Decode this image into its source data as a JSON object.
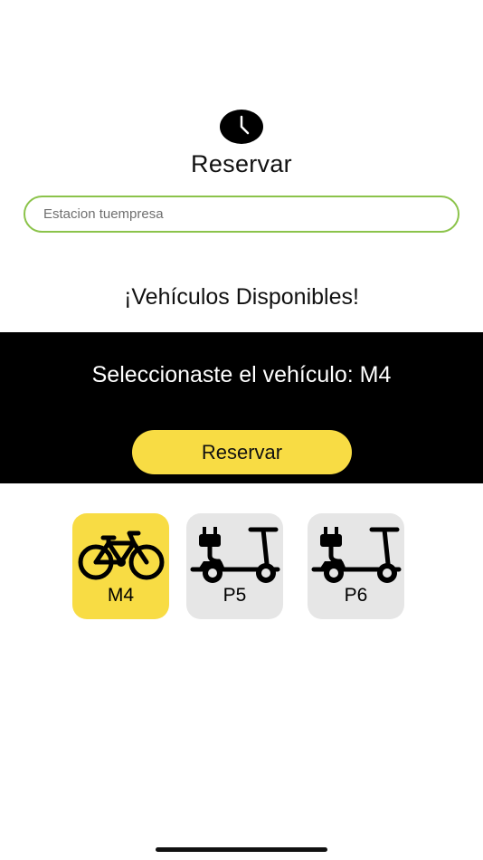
{
  "header": {
    "icon": "clock-icon",
    "title": "Reservar"
  },
  "search": {
    "placeholder": "Estacion tuempresa",
    "value": ""
  },
  "vehicles_heading": "¡Vehículos Disponibles!",
  "selection": {
    "text": "Seleccionaste el vehículo: M4",
    "button_label": "Reservar"
  },
  "vehicles": [
    {
      "label": "M4",
      "icon": "bicycle-icon",
      "selected": true
    },
    {
      "label": "P5",
      "icon": "electric-scooter-icon",
      "selected": false
    },
    {
      "label": "P6",
      "icon": "electric-scooter-icon",
      "selected": false
    }
  ],
  "colors": {
    "accent_yellow": "#f8dc44",
    "input_border_green": "#8bc34a",
    "panel_black": "#000000",
    "card_gray": "#e6e6e6"
  }
}
